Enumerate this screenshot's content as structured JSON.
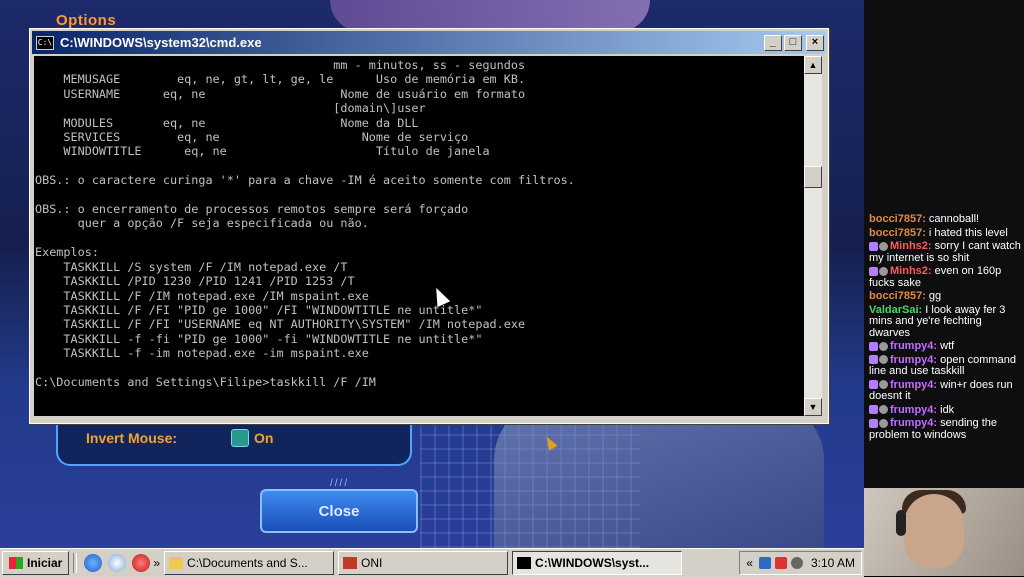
{
  "game": {
    "options_label": "Options",
    "invert_mouse_label": "Invert Mouse:",
    "invert_mouse_value": "On",
    "close_label": "Close"
  },
  "cmd": {
    "title": "C:\\WINDOWS\\system32\\cmd.exe",
    "icon": "cmd-icon",
    "lines": [
      "                                          mm - minutos, ss - segundos",
      "    MEMUSAGE        eq, ne, gt, lt, ge, le      Uso de memória em KB.",
      "    USERNAME      eq, ne                   Nome de usuário em formato",
      "                                          [domain\\]user",
      "    MODULES       eq, ne                   Nome da DLL",
      "    SERVICES        eq, ne                    Nome de serviço",
      "    WINDOWTITLE      eq, ne                     Título de janela",
      "",
      "OBS.: o caractere curinga '*' para a chave -IM é aceito somente com filtros.",
      "",
      "OBS.: o encerramento de processos remotos sempre será forçado",
      "      quer a opção /F seja especificada ou não.",
      "",
      "Exemplos:",
      "    TASKKILL /S system /F /IM notepad.exe /T",
      "    TASKKILL /PID 1230 /PID 1241 /PID 1253 /T",
      "    TASKKILL /F /IM notepad.exe /IM mspaint.exe",
      "    TASKKILL /F /FI \"PID ge 1000\" /FI \"WINDOWTITLE ne untitle*\"",
      "    TASKKILL /F /FI \"USERNAME eq NT AUTHORITY\\SYSTEM\" /IM notepad.exe",
      "    TASKKILL -f -fi \"PID ge 1000\" -fi \"WINDOWTITLE ne untitle*\"",
      "    TASKKILL -f -im notepad.exe -im mspaint.exe",
      "",
      "C:\\Documents and Settings\\Filipe>taskkill /F /IM"
    ]
  },
  "chat": {
    "messages": [
      {
        "user": "bocci7857",
        "color": "#e08a3c",
        "text": " cannoball!",
        "badges": 0
      },
      {
        "user": "bocci7857",
        "color": "#e08a3c",
        "text": " i hated this level",
        "badges": 0
      },
      {
        "user": "Minhs2",
        "color": "#ff5a5a",
        "text": " sorry I cant watch my internet is so shit",
        "badges": 2
      },
      {
        "user": "Minhs2",
        "color": "#ff5a5a",
        "text": " even on 160p fucks sake",
        "badges": 2
      },
      {
        "user": "bocci7857",
        "color": "#e08a3c",
        "text": " gg",
        "badges": 0
      },
      {
        "user": "ValdarSai",
        "color": "#4fd36b",
        "text": " I look away fer 3 mins and ye're fechting dwarves",
        "badges": 0
      },
      {
        "user": "frumpy4",
        "color": "#c36dff",
        "text": " wtf",
        "badges": 2
      },
      {
        "user": "frumpy4",
        "color": "#c36dff",
        "text": " open command line and use taskkill",
        "badges": 2
      },
      {
        "user": "frumpy4",
        "color": "#c36dff",
        "text": " win+r does run doesnt it",
        "badges": 2
      },
      {
        "user": "frumpy4",
        "color": "#c36dff",
        "text": " idk",
        "badges": 2
      },
      {
        "user": "frumpy4",
        "color": "#c36dff",
        "text": " sending the problem to windows",
        "badges": 2
      }
    ]
  },
  "taskbar": {
    "start_label": "Iniciar",
    "tasks": [
      {
        "label": "C:\\Documents and S...",
        "icon": "folder-icon",
        "active": false
      },
      {
        "label": "ONI",
        "icon": "oni-icon",
        "active": false
      },
      {
        "label": "C:\\WINDOWS\\syst...",
        "icon": "cmd-icon",
        "active": true
      }
    ],
    "quick_launch_more": "»",
    "tray_more": "«",
    "clock": "3:10 AM"
  }
}
